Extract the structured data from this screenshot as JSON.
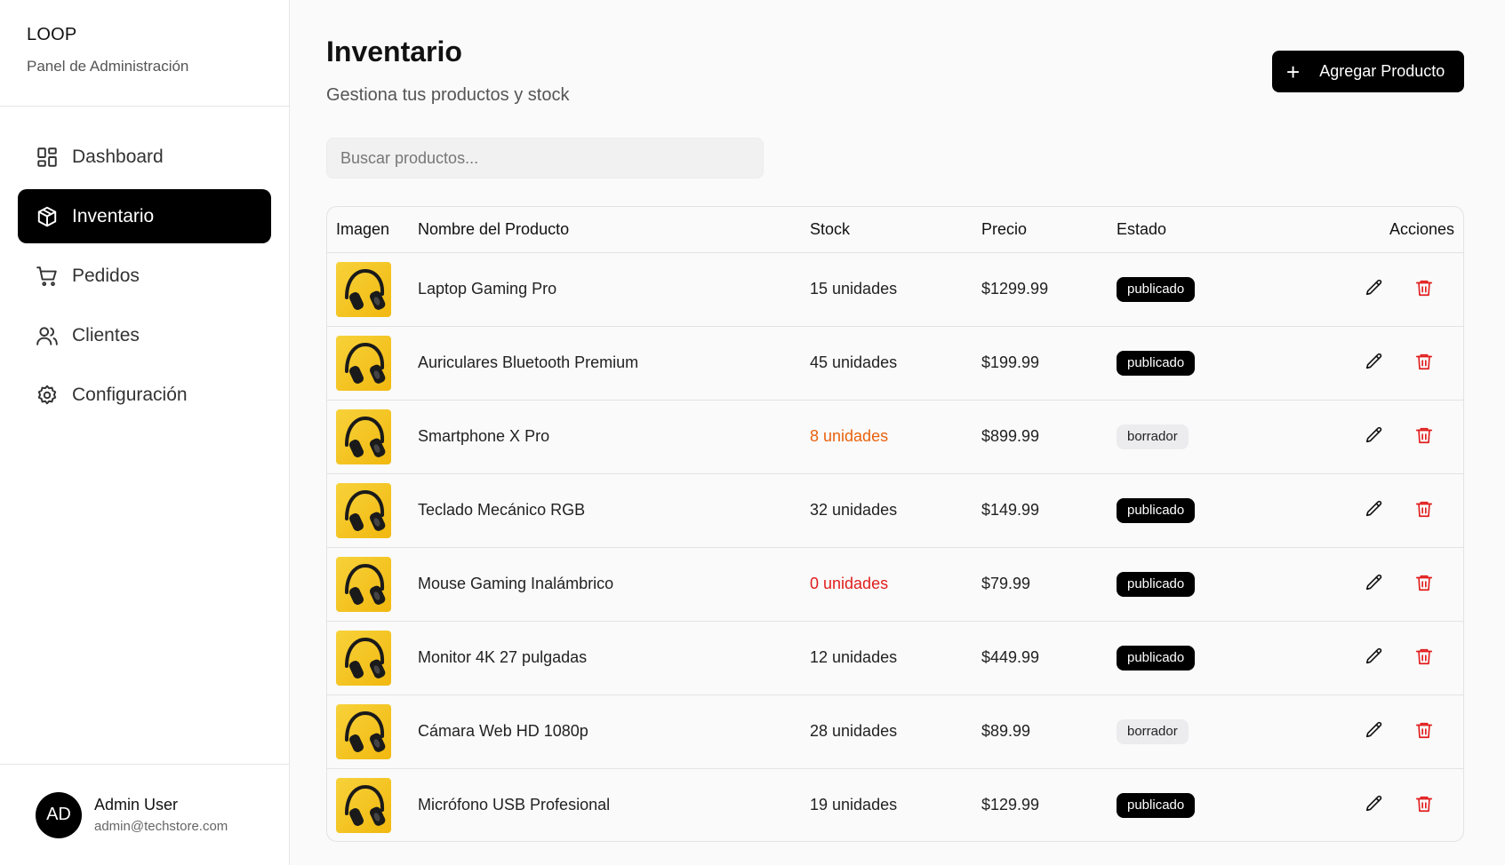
{
  "sidebar": {
    "brand": "LOOP",
    "subtitle": "Panel de Administración",
    "items": [
      {
        "label": "Dashboard",
        "icon": "dashboard-icon"
      },
      {
        "label": "Inventario",
        "icon": "package-icon",
        "active": true
      },
      {
        "label": "Pedidos",
        "icon": "cart-icon"
      },
      {
        "label": "Clientes",
        "icon": "users-icon"
      },
      {
        "label": "Configuración",
        "icon": "gear-icon"
      }
    ],
    "user": {
      "initials": "AD",
      "name": "Admin User",
      "email": "admin@techstore.com"
    }
  },
  "header": {
    "title": "Inventario",
    "subtitle": "Gestiona tus productos y stock",
    "add_label": "Agregar Producto"
  },
  "search": {
    "placeholder": "Buscar productos..."
  },
  "table": {
    "columns": [
      "Imagen",
      "Nombre del Producto",
      "Stock",
      "Precio",
      "Estado",
      "Acciones"
    ],
    "rows": [
      {
        "name": "Laptop Gaming Pro",
        "stock": "15 unidades",
        "price": "$1299.99",
        "status": "publicado"
      },
      {
        "name": "Auriculares Bluetooth Premium",
        "stock": "45 unidades",
        "price": "$199.99",
        "status": "publicado"
      },
      {
        "name": "Smartphone X Pro",
        "stock": "8 unidades",
        "price": "$899.99",
        "status": "borrador"
      },
      {
        "name": "Teclado Mecánico RGB",
        "stock": "32 unidades",
        "price": "$149.99",
        "status": "publicado"
      },
      {
        "name": "Mouse Gaming Inalámbrico",
        "stock": "0 unidades",
        "price": "$79.99",
        "status": "publicado"
      },
      {
        "name": "Monitor 4K 27 pulgadas",
        "stock": "12 unidades",
        "price": "$449.99",
        "status": "publicado"
      },
      {
        "name": "Cámara Web HD 1080p",
        "stock": "28 unidades",
        "price": "$89.99",
        "status": "borrador"
      },
      {
        "name": "Micrófono USB Profesional",
        "stock": "19 unidades",
        "price": "$129.99",
        "status": "publicado"
      }
    ]
  },
  "colors": {
    "accent": "#000000",
    "low_stock": "#e8620e",
    "out_of_stock": "#e11d1d",
    "delete": "#e11d1d"
  }
}
